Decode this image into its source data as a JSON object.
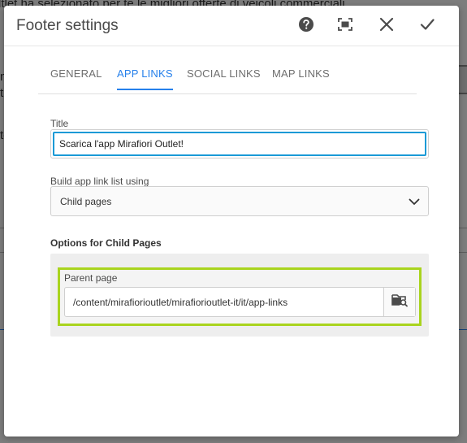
{
  "background": {
    "line1": "ltlet ha selezionato per te le migliori offerte di veicoli commerciali",
    "frag_m": "m",
    "frag_t": "t",
    "frag_to": "to"
  },
  "dialog": {
    "title": "Footer settings",
    "help_icon": "help-icon",
    "fullscreen_icon": "fullscreen-icon",
    "close_icon": "close-icon",
    "confirm_icon": "check-icon"
  },
  "tabs": [
    {
      "label": "GENERAL"
    },
    {
      "label": "APP LINKS"
    },
    {
      "label": "SOCIAL LINKS"
    },
    {
      "label": "MAP LINKS"
    }
  ],
  "form": {
    "title_label": "Title",
    "title_value": "Scarica l'app Mirafiori Outlet!",
    "build_label": "Build app link list using",
    "build_value": "Child pages",
    "options_heading": "Options for Child Pages",
    "parent_label": "Parent page",
    "parent_value": "/content/mirafiorioutlet/mirafiorioutlet-it/it/app-links"
  },
  "colors": {
    "accent": "#2680eb",
    "focus": "#1a9ad6",
    "highlight": "#a9d41e"
  }
}
